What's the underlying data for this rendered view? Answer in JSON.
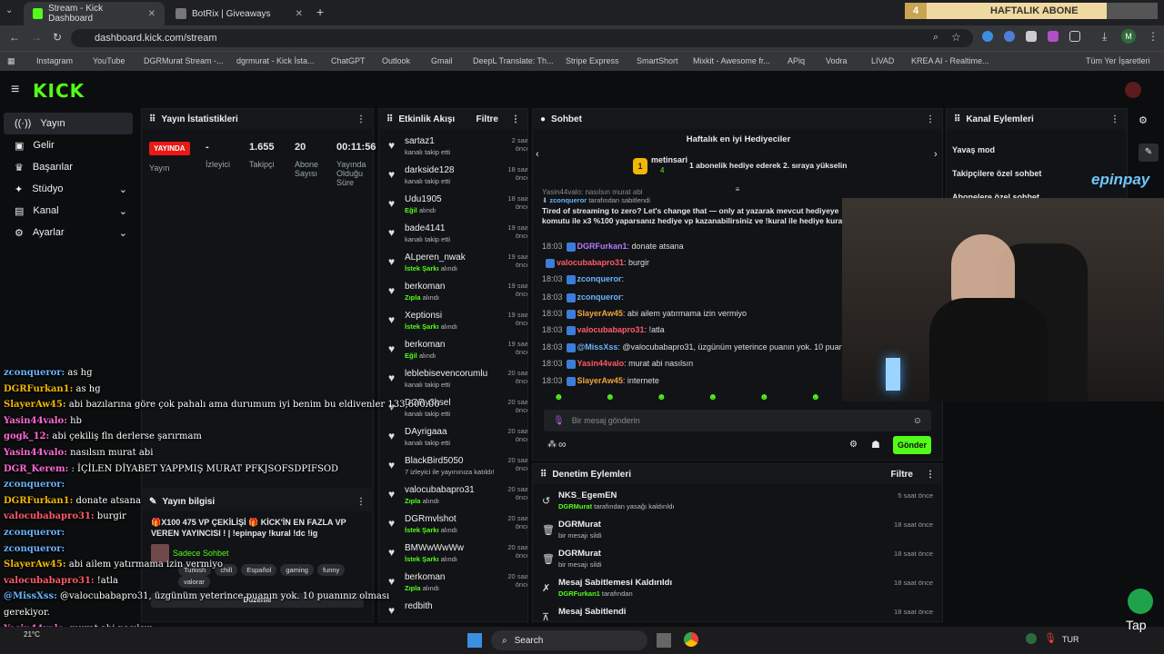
{
  "browser": {
    "tabs": [
      {
        "label": "Stream - Kick Dashboard"
      },
      {
        "label": "BotRix | Giveaways"
      }
    ],
    "new_tab": "+",
    "url": "dashboard.kick.com/stream",
    "ext_banner": {
      "count": "4",
      "label": "HAFTALIK ABONE"
    },
    "bookmarks": [
      "Instagram",
      "YouTube",
      "DGRMurat Stream -...",
      "dgrmurat - Kick İsta...",
      "ChatGPT",
      "Outlook",
      "Gmail",
      "DeepL Translate: Th...",
      "Stripe Express",
      "SmartShort",
      "Mixkit - Awesome fr...",
      "APiq",
      "Vodra",
      "LIVAD",
      "KREA AI - Realtime...",
      "Tüm Yer İşaretleri"
    ],
    "profile": "M"
  },
  "nav": {
    "items": [
      {
        "label": "Yayın"
      },
      {
        "label": "Gelir"
      },
      {
        "label": "Başarılar"
      },
      {
        "label": "Stüdyo"
      },
      {
        "label": "Kanal"
      },
      {
        "label": "Ayarlar"
      }
    ]
  },
  "stats": {
    "title": "Yayın İstatistikleri",
    "live": "YAYINDA",
    "live_label": "Yayın",
    "viewers": "-",
    "viewers_label": "İzleyici",
    "followers": "1.655",
    "followers_label": "Takipçi",
    "subs": "20",
    "subs_label": "Abone Sayısı",
    "uptime": "00:11:56",
    "uptime_label": "Yayında Olduğu Süre"
  },
  "activity": {
    "title": "Etkinlik Akışı",
    "filter": "Filtre",
    "items": [
      {
        "name": "sartaz1",
        "sub": "kanalı takip etti",
        "bold": "",
        "time": "2 saat önce"
      },
      {
        "name": "darkside128",
        "sub": "kanalı takip etti",
        "bold": "",
        "time": "18 saat önce"
      },
      {
        "name": "Udu1905",
        "sub": " alındı",
        "bold": "Eğil",
        "time": "18 saat önce"
      },
      {
        "name": "bade4141",
        "sub": "kanalı takip etti",
        "bold": "",
        "time": "19 saat önce"
      },
      {
        "name": "ALperen_nwak",
        "sub": " alındı",
        "bold": "İstek Şarkı",
        "time": "19 saat önce"
      },
      {
        "name": "berkoman",
        "sub": " alındı",
        "bold": "Zıpla",
        "time": "19 saat önce"
      },
      {
        "name": "Xeptionsi",
        "sub": " alındı",
        "bold": "İstek Şarkı",
        "time": "19 saat önce"
      },
      {
        "name": "berkoman",
        "sub": " alındı",
        "bold": "Eğil",
        "time": "19 saat önce"
      },
      {
        "name": "leblebisevencorumlu",
        "sub": "kanalı takip etti",
        "bold": "",
        "time": "20 saat önce"
      },
      {
        "name": "DGRy3ksel",
        "sub": "kanalı takip etti",
        "bold": "",
        "time": "20 saat önce"
      },
      {
        "name": "DAyrigaaa",
        "sub": "kanalı takip etti",
        "bold": "",
        "time": "20 saat önce"
      },
      {
        "name": "BlackBird5050",
        "sub": "7 izleyici ile yayınınıza katıldı!",
        "bold": "",
        "time": "20 saat önce"
      },
      {
        "name": "valocubabapro31",
        "sub": " alındı",
        "bold": "Zıpla",
        "time": "20 saat önce"
      },
      {
        "name": "DGRmvlshot",
        "sub": " alındı",
        "bold": "İstek Şarkı",
        "time": "20 saat önce"
      },
      {
        "name": "BMWwWwWw",
        "sub": " alındı",
        "bold": "İstek Şarkı",
        "time": "20 saat önce"
      },
      {
        "name": "berkoman",
        "sub": " alındı",
        "bold": "Zıpla",
        "time": "20 saat önce"
      },
      {
        "name": "redbith",
        "sub": "",
        "bold": "",
        "time": ""
      }
    ]
  },
  "chat": {
    "title": "Sohbet",
    "gifter_title": "Haftalık en iyi Hediyeciler",
    "gifter_name": "metinsari",
    "gifter_count": "4",
    "gifter_rank": "1",
    "gifter_msg": "1 abonelik hediye ederek 2. sıraya yükselin",
    "pinned_by": "zconqueror",
    "pinned_suffix": "tarafından sabitlendi",
    "pinned_text": "Tired of streaming to zero? Let's change that — only at yazarak mevcut hediyeye",
    "pinned_text2": "komutu ile x3 %100 yaparsanız hediye vp kazanabilirsiniz ve !kural ile hediye kura",
    "top_partial": "Yasin44valo: nasılsın murat abi",
    "messages": [
      {
        "time": "18:03",
        "user": "DGRFurkan1",
        "cls": "u-purple",
        "text": ": donate atsana"
      },
      {
        "time": "",
        "user": "valocubabapro31",
        "cls": "u-red",
        "text": ": burgir"
      },
      {
        "time": "18:03",
        "user": "zconqueror",
        "cls": "u-blue",
        "text": ":"
      },
      {
        "time": "18:03",
        "user": "zconqueror",
        "cls": "u-blue",
        "text": ":"
      },
      {
        "time": "18:03",
        "user": "SlayerAw45",
        "cls": "u-orange",
        "text": ": abi ailem yatırmama izin vermiyo"
      },
      {
        "time": "18:03",
        "user": "valocubabapro31",
        "cls": "u-red",
        "text": ": !atla"
      },
      {
        "time": "18:03",
        "user": "@MissXss",
        "cls": "u-blue",
        "text": ": @valocubabapro31, üzgünüm yeterince puanın yok. 10 puanınız olm"
      },
      {
        "time": "18:03",
        "user": "Yasin44valo",
        "cls": "u-red",
        "text": ": murat abi nasılsın"
      },
      {
        "time": "18:03",
        "user": "SlayerAw45",
        "cls": "u-orange",
        "text": ": internete"
      }
    ],
    "placeholder": "Bir mesaj gönderin",
    "send": "Gönder",
    "infinity": "∞"
  },
  "channel_actions": {
    "title": "Kanal Eylemleri",
    "items": [
      "Yavaş mod",
      "Takipçilere özel sohbet",
      "Abonelere özel sohbet"
    ]
  },
  "stream_info": {
    "title": "Yayın bilgisi",
    "text": "🎁X100 475 VP ÇEKİLİŞİ 🎁 KİCK'İN EN FAZLA VP VEREN YAYINCISI ! | !epinpay !kural !dc !ig",
    "chat_mode": "Sadece Sohbet",
    "tags": [
      "Turkish",
      "chill",
      "Español",
      "gaming",
      "funny",
      "valorar"
    ],
    "edit": "Düzenle"
  },
  "moderation": {
    "title": "Denetim Eylemleri",
    "filter": "Filtre",
    "items": [
      {
        "title": "NKS_EgemEN",
        "by": "DGRMurat",
        "suffix": " tarafından yasağı kaldırıldı",
        "time": "5 saat önce"
      },
      {
        "title": "DGRMurat",
        "by": "",
        "suffix": "bir mesajı sildi",
        "time": "18 saat önce"
      },
      {
        "title": "DGRMurat",
        "by": "",
        "suffix": "bir mesajı sildi",
        "time": "18 saat önce"
      },
      {
        "title": "Mesaj Sabitlemesi Kaldırıldı",
        "by": "DGRFurkan1",
        "suffix": " tarafından",
        "time": "18 saat önce"
      },
      {
        "title": "Mesaj Sabitlendi",
        "by": "",
        "suffix": "",
        "time": "18 saat önce"
      }
    ]
  },
  "overlay": {
    "brand": "epinpay",
    "lines": [
      {
        "u": "zconqueror:",
        "t": " as hg"
      },
      {
        "u": "DGRFurkan1:",
        "t": " as hg"
      },
      {
        "u": "SlayerAw45:",
        "t": " abi bazılarına göre çok pahalı ama durumum iyi benim bu eldivenler 133,600.00"
      },
      {
        "u": "Yasin44valo:",
        "t": " hb"
      },
      {
        "u": "gogk_12:",
        "t": " abi çekiliş fln derlerse şarırmam"
      },
      {
        "u": "Yasin44valo:",
        "t": " nasılsın murat abi"
      },
      {
        "u": "DGR_Kerem:",
        "t": " : İÇİLEN DİYABET YAPPMIŞ MURAT PFKJSOFSDPIFSOD"
      },
      {
        "u": "zconqueror:",
        "t": ""
      },
      {
        "u": "DGRFurkan1:",
        "t": " donate atsana"
      },
      {
        "u": "valocubabapro31:",
        "t": " burgir"
      },
      {
        "u": "zconqueror:",
        "t": ""
      },
      {
        "u": "zconqueror:",
        "t": ""
      },
      {
        "u": "SlayerAw45:",
        "t": " abi ailem yatırmama izin vermiyo"
      },
      {
        "u": "valocubabapro31:",
        "t": " !atla"
      },
      {
        "u": "@MissXss:",
        "t": " @valocubabapro31, üzgünüm yeterince puanın yok. 10 puanınız olması"
      },
      {
        "u": "",
        "t": "gerekiyor."
      },
      {
        "u": "Yasin44valo:",
        "t": " murat abi nasılsın"
      },
      {
        "u": "SlayerAw45:",
        "t": " internete"
      }
    ]
  },
  "taskbar": {
    "search": "Search",
    "lang": "TUR",
    "temp": "21°C",
    "tap": "Tap"
  },
  "colors": {
    "kick_green": "#53fc18",
    "live_red": "#e91916"
  }
}
